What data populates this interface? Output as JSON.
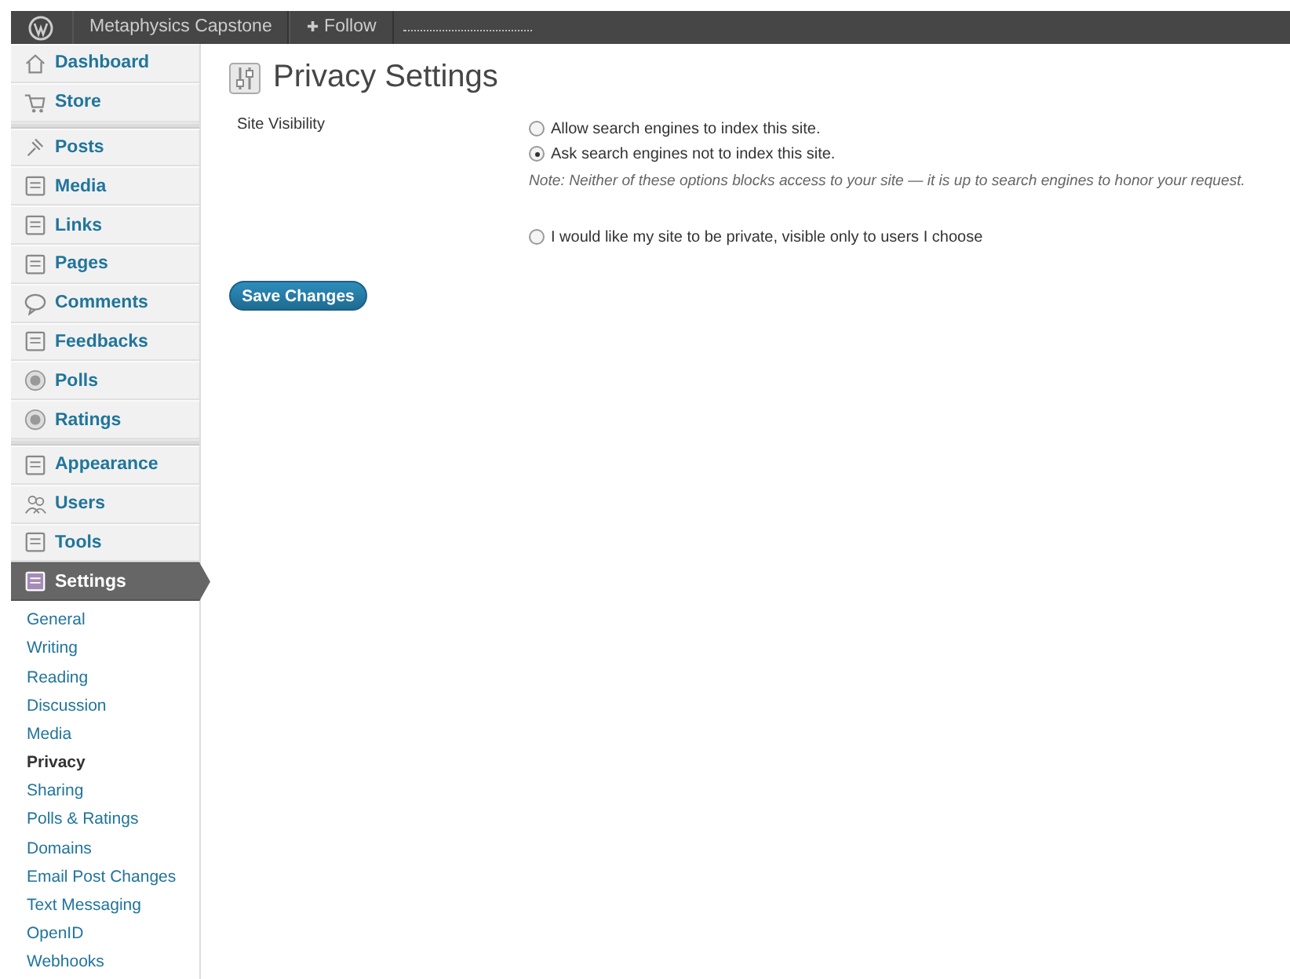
{
  "admin_bar": {
    "site_name": "Metaphysics Capstone",
    "follow": "Follow",
    "follow_icon": "✚"
  },
  "sidebar": {
    "groups": [
      [
        {
          "label": "Dashboard",
          "selected": false
        },
        {
          "label": "Store",
          "selected": false
        }
      ],
      [
        {
          "label": "Posts",
          "selected": false
        },
        {
          "label": "Media",
          "selected": false
        },
        {
          "label": "Links",
          "selected": false
        },
        {
          "label": "Pages",
          "selected": false
        },
        {
          "label": "Comments",
          "selected": false
        },
        {
          "label": "Feedbacks",
          "selected": false
        },
        {
          "label": "Polls",
          "selected": false
        },
        {
          "label": "Ratings",
          "selected": false
        }
      ],
      [
        {
          "label": "Appearance",
          "selected": false
        },
        {
          "label": "Users",
          "selected": false
        },
        {
          "label": "Tools",
          "selected": false
        },
        {
          "label": "Settings",
          "selected": true,
          "children": [
            {
              "label": "General",
              "selected": false
            },
            {
              "label": "Writing",
              "selected": false
            },
            {
              "label": "Reading",
              "selected": false
            },
            {
              "label": "Discussion",
              "selected": false
            },
            {
              "label": "Media",
              "selected": false
            },
            {
              "label": "Privacy",
              "selected": true
            },
            {
              "label": "Sharing",
              "selected": false
            },
            {
              "label": "Polls & Ratings",
              "selected": false
            },
            {
              "label": "Domains",
              "selected": false
            },
            {
              "label": "Email Post Changes",
              "selected": false
            },
            {
              "label": "Text Messaging",
              "selected": false
            },
            {
              "label": "OpenID",
              "selected": false
            },
            {
              "label": "Webhooks",
              "selected": false
            }
          ]
        }
      ]
    ]
  },
  "page": {
    "title": "Privacy Settings",
    "field_label": "Site Visibility",
    "options": [
      {
        "label": "Allow search engines to index this site.",
        "selected": false
      },
      {
        "label": "Ask search engines not to index this site.",
        "selected": true
      }
    ],
    "note": "Note: Neither of these options blocks access to your site — it is up to search engines to honor your request.",
    "private_option": {
      "label": "I would like my site to be private, visible only to users I choose",
      "selected": false
    },
    "save_button": "Save Changes"
  }
}
